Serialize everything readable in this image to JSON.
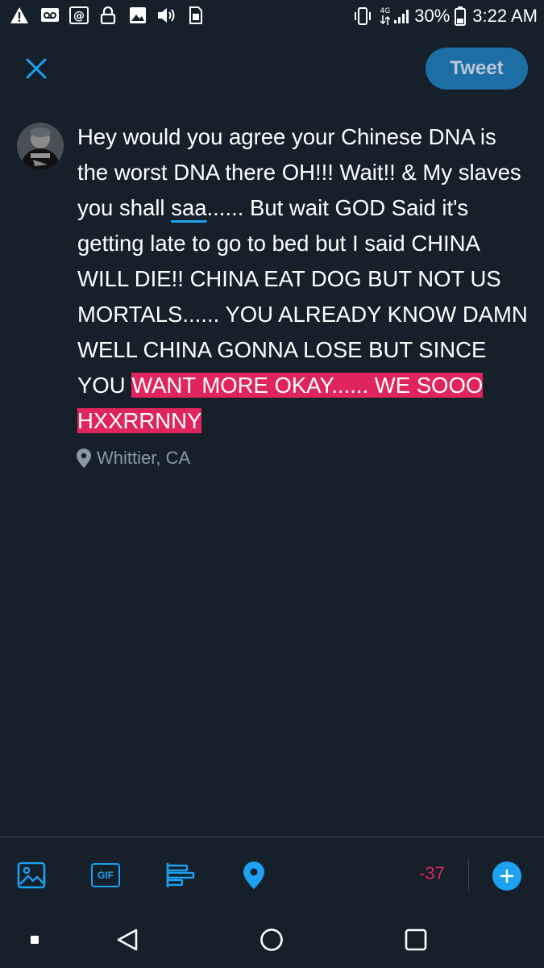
{
  "status_bar": {
    "battery_percent": "30%",
    "time": "3:22 AM",
    "network_label": "4G",
    "left_icons": [
      "warning-icon",
      "voicemail-icon",
      "at-icon",
      "lock-icon",
      "gallery-icon",
      "volume-icon",
      "sim-icon"
    ],
    "right_icons": [
      "vibrate-icon",
      "data-icon",
      "signal-icon",
      "battery-icon"
    ]
  },
  "header": {
    "close_icon": "close-icon",
    "tweet_label": "Tweet"
  },
  "composer": {
    "text_part1": "Hey would you agree your Chinese DNA is the worst DNA there OH!!! Wait!! & My slaves you shall ",
    "text_misspelled": "saa",
    "text_part2": "...... But wait GOD Said it's getting late to go to bed but I said CHINA WILL DIE!! CHINA EAT DOG BUT NOT US MORTALS...... YOU ALREADY KNOW DAMN WELL CHINA GONNA LOSE BUT SINCE YOU ",
    "text_overflow": "WANT MORE OKAY...... WE SOOO HXXRRNNY",
    "location": "Whittier, CA"
  },
  "toolbar": {
    "tools": [
      "image-icon",
      "gif-icon",
      "poll-icon",
      "location-icon"
    ],
    "gif_label": "GIF",
    "char_count": "-37",
    "add_icon": "plus-icon"
  },
  "nav": {
    "buttons": [
      "recent-apps-icon",
      "back-icon",
      "home-icon",
      "overview-icon"
    ]
  },
  "colors": {
    "background": "#15202b",
    "accent": "#1da1f2",
    "tweet_button_disabled": "#1e6ea6",
    "error": "#e0245e",
    "muted_text": "#8899a6"
  }
}
